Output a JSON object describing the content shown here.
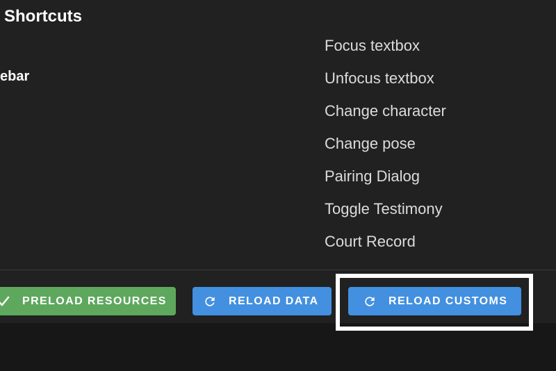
{
  "header": {
    "title": "Shortcuts",
    "sidebar_label_fragment": "ebar"
  },
  "shortcuts": [
    {
      "label": "Focus textbox"
    },
    {
      "label": "Unfocus textbox"
    },
    {
      "label": "Change character"
    },
    {
      "label": "Change pose"
    },
    {
      "label": "Pairing Dialog"
    },
    {
      "label": "Toggle Testimony"
    },
    {
      "label": "Court Record"
    }
  ],
  "footer": {
    "preload_button": {
      "label": "PRELOAD RESOURCES",
      "icon": "check-icon",
      "color": "#5ea85e"
    },
    "reload_data_button": {
      "label": "RELOAD DATA",
      "icon": "refresh-icon",
      "color": "#4390e0"
    },
    "reload_customs_button": {
      "label": "RELOAD CUSTOMS",
      "icon": "refresh-icon",
      "color": "#4390e0",
      "highlighted": true
    }
  }
}
